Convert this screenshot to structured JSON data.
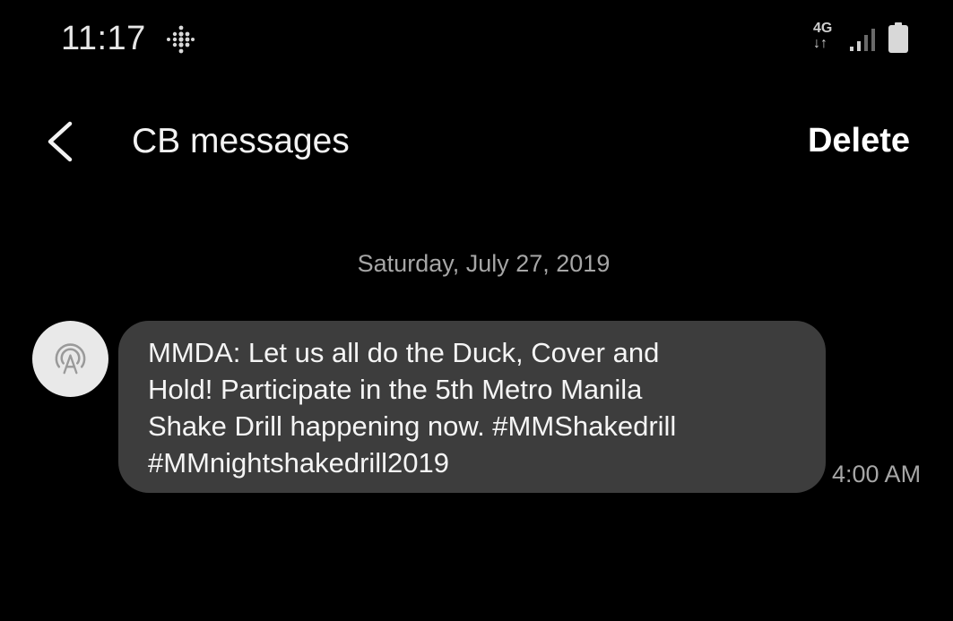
{
  "status_bar": {
    "time": "11:17",
    "network": "4G",
    "network_arrows": "↓↑",
    "icons": [
      "fitbit-icon",
      "signal-icon",
      "battery-icon"
    ]
  },
  "toolbar": {
    "title": "CB messages",
    "delete_label": "Delete",
    "back_icon": "chevron-left-icon"
  },
  "conversation": {
    "date": "Saturday, July 27, 2019",
    "messages": [
      {
        "sender_icon": "broadcast-icon",
        "text": "MMDA: Let us all do the Duck, Cover and\nHold! Participate in the 5th Metro Manila\nShake Drill happening now. #MMShakedrill\n#MMnightshakedrill2019",
        "time": "4:00 AM"
      }
    ]
  },
  "colors": {
    "background": "#000000",
    "bubble": "#3d3d3d",
    "secondary_text": "#a6a6a6",
    "avatar": "#e9e9e9"
  }
}
